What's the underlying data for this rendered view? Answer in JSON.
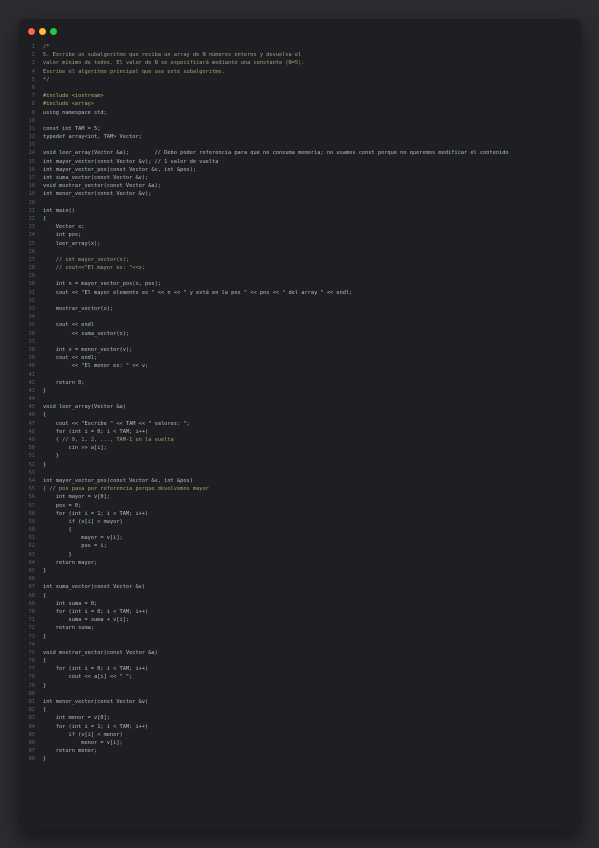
{
  "window": {
    "controls": [
      "close",
      "minimize",
      "maximize"
    ]
  },
  "colors": {
    "background": "#2c2d30",
    "editor": "#1e1f22",
    "code_text": "#b8bcc2",
    "comment_text": "#a6a07a",
    "line_number": "#5c5f66"
  },
  "code": {
    "lines": [
      {
        "n": "1",
        "text": "/*",
        "kind": "comment"
      },
      {
        "n": "2",
        "text": "5. Escribe un subalgoritmo que reciba un array de N números enteros y devuelva el",
        "kind": "comment"
      },
      {
        "n": "3",
        "text": "valor mínimo de todos. El valor de N se especificará mediante una constante (N=5).",
        "kind": "comment"
      },
      {
        "n": "4",
        "text": "Escribe el algoritmo principal que use este subalgoritmo.",
        "kind": "comment"
      },
      {
        "n": "5",
        "text": "*/",
        "kind": "comment"
      },
      {
        "n": "6",
        "text": "",
        "kind": "code"
      },
      {
        "n": "7",
        "text": "#include <iostream>",
        "kind": "directive"
      },
      {
        "n": "8",
        "text": "#include <array>",
        "kind": "directive"
      },
      {
        "n": "9",
        "text": "using namespace std;",
        "kind": "code"
      },
      {
        "n": "10",
        "text": "",
        "kind": "code"
      },
      {
        "n": "11",
        "text": "const int TAM = 5;",
        "kind": "code"
      },
      {
        "n": "12",
        "text": "typedef array<int, TAM> Vector;",
        "kind": "code"
      },
      {
        "n": "13",
        "text": "",
        "kind": "code"
      },
      {
        "n": "14",
        "text": "void leer_array(Vector &a);        // Debo poder referencia para que no consuma memoria; no usamos const porque no queremos modificar el contenido",
        "kind": "code"
      },
      {
        "n": "15",
        "text": "int mayor_vector(const Vector &v); // 1 valor de vuelta",
        "kind": "code"
      },
      {
        "n": "16",
        "text": "int mayor_vector_pos(const Vector &v, int &pos);",
        "kind": "code"
      },
      {
        "n": "17",
        "text": "int suma_vector(const Vector &v);",
        "kind": "code"
      },
      {
        "n": "18",
        "text": "void mostrar_vector(const Vector &a);",
        "kind": "code"
      },
      {
        "n": "19",
        "text": "int menor_vector(const Vector &v);",
        "kind": "code"
      },
      {
        "n": "20",
        "text": "",
        "kind": "code"
      },
      {
        "n": "21",
        "text": "int main()",
        "kind": "code"
      },
      {
        "n": "22",
        "text": "{",
        "kind": "code"
      },
      {
        "n": "23",
        "text": "    Vector x;",
        "kind": "code"
      },
      {
        "n": "24",
        "text": "    int pos;",
        "kind": "code"
      },
      {
        "n": "25",
        "text": "    leer_array(x);",
        "kind": "code"
      },
      {
        "n": "26",
        "text": "",
        "kind": "code"
      },
      {
        "n": "27",
        "text": "    // int mayor_vector(x);",
        "kind": "comment"
      },
      {
        "n": "28",
        "text": "    // cout<<\"El mayor es: \"<<x;",
        "kind": "comment"
      },
      {
        "n": "29",
        "text": "",
        "kind": "code"
      },
      {
        "n": "30",
        "text": "    int n = mayor_vector_pos(x, pos);",
        "kind": "code"
      },
      {
        "n": "31",
        "text": "    cout << \"El mayor elemento es \" << n << \" y está en la pos \" << pos << \" del array \" << endl;",
        "kind": "code"
      },
      {
        "n": "32",
        "text": "",
        "kind": "code"
      },
      {
        "n": "33",
        "text": "    mostrar_vector(x);",
        "kind": "code"
      },
      {
        "n": "34",
        "text": "",
        "kind": "code"
      },
      {
        "n": "35",
        "text": "    cout << endl",
        "kind": "code"
      },
      {
        "n": "36",
        "text": "         << suma_vector(x);",
        "kind": "code"
      },
      {
        "n": "37",
        "text": "",
        "kind": "code"
      },
      {
        "n": "38",
        "text": "    int v = menor_vector(v);",
        "kind": "code"
      },
      {
        "n": "39",
        "text": "    cout << endl;",
        "kind": "code"
      },
      {
        "n": "40",
        "text": "         << \"El menor es: \" << v;",
        "kind": "code"
      },
      {
        "n": "41",
        "text": "",
        "kind": "code"
      },
      {
        "n": "42",
        "text": "    return 0;",
        "kind": "code"
      },
      {
        "n": "43",
        "text": "}",
        "kind": "code"
      },
      {
        "n": "44",
        "text": "",
        "kind": "code"
      },
      {
        "n": "45",
        "text": "void leer_array(Vector &a)",
        "kind": "code"
      },
      {
        "n": "46",
        "text": "{",
        "kind": "code"
      },
      {
        "n": "47",
        "text": "    cout << \"Escribe \" << TAM << \" valores: \";",
        "kind": "code"
      },
      {
        "n": "48",
        "text": "    for (int i = 0; i < TAM; i++)",
        "kind": "code"
      },
      {
        "n": "49",
        "text": "    { // 0, 1, 2, ..., TAM-1 en la vuelta",
        "kind": "comment"
      },
      {
        "n": "50",
        "text": "        cin >> a[i];",
        "kind": "code"
      },
      {
        "n": "51",
        "text": "    }",
        "kind": "code"
      },
      {
        "n": "52",
        "text": "}",
        "kind": "code"
      },
      {
        "n": "53",
        "text": "",
        "kind": "code"
      },
      {
        "n": "54",
        "text": "int mayor_vector_pos(const Vector &v, int &pos)",
        "kind": "code"
      },
      {
        "n": "55",
        "text": "{ // pos pasa por referencia porque devolvemos mayor",
        "kind": "comment"
      },
      {
        "n": "56",
        "text": "    int mayor = v[0];",
        "kind": "code"
      },
      {
        "n": "57",
        "text": "    pos = 0;",
        "kind": "code"
      },
      {
        "n": "58",
        "text": "    for (int i = 1; i < TAM; i++)",
        "kind": "code"
      },
      {
        "n": "59",
        "text": "        if (v[i] > mayor)",
        "kind": "code"
      },
      {
        "n": "60",
        "text": "        {",
        "kind": "code"
      },
      {
        "n": "61",
        "text": "            mayor = v[i];",
        "kind": "code"
      },
      {
        "n": "62",
        "text": "            pos = i;",
        "kind": "code"
      },
      {
        "n": "63",
        "text": "        }",
        "kind": "code"
      },
      {
        "n": "64",
        "text": "    return mayor;",
        "kind": "code"
      },
      {
        "n": "65",
        "text": "}",
        "kind": "code"
      },
      {
        "n": "66",
        "text": "",
        "kind": "code"
      },
      {
        "n": "67",
        "text": "int suma_vector(const Vector &v)",
        "kind": "code"
      },
      {
        "n": "68",
        "text": "{",
        "kind": "code"
      },
      {
        "n": "69",
        "text": "    int suma = 0;",
        "kind": "code"
      },
      {
        "n": "70",
        "text": "    for (int i = 0; i < TAM; i++)",
        "kind": "code"
      },
      {
        "n": "71",
        "text": "        suma = suma + v[i];",
        "kind": "code"
      },
      {
        "n": "72",
        "text": "    return suma;",
        "kind": "code"
      },
      {
        "n": "73",
        "text": "}",
        "kind": "code"
      },
      {
        "n": "74",
        "text": "",
        "kind": "code"
      },
      {
        "n": "75",
        "text": "void mostrar_vector(const Vector &a)",
        "kind": "code"
      },
      {
        "n": "76",
        "text": "{",
        "kind": "code"
      },
      {
        "n": "77",
        "text": "    for (int i = 0; i < TAM; i++)",
        "kind": "code"
      },
      {
        "n": "78",
        "text": "        cout << a[i] << \" \";",
        "kind": "code"
      },
      {
        "n": "79",
        "text": "}",
        "kind": "code"
      },
      {
        "n": "80",
        "text": "",
        "kind": "code"
      },
      {
        "n": "81",
        "text": "int menor_vector(const Vector &v)",
        "kind": "code"
      },
      {
        "n": "82",
        "text": "{",
        "kind": "code"
      },
      {
        "n": "83",
        "text": "    int menor = v[0];",
        "kind": "code"
      },
      {
        "n": "84",
        "text": "    for (int i = 1; i < TAM; i++)",
        "kind": "code"
      },
      {
        "n": "85",
        "text": "        if (v[i] < menor)",
        "kind": "code"
      },
      {
        "n": "86",
        "text": "            menor = v[i];",
        "kind": "code"
      },
      {
        "n": "87",
        "text": "    return menor;",
        "kind": "code"
      },
      {
        "n": "88",
        "text": "}",
        "kind": "code"
      }
    ]
  }
}
